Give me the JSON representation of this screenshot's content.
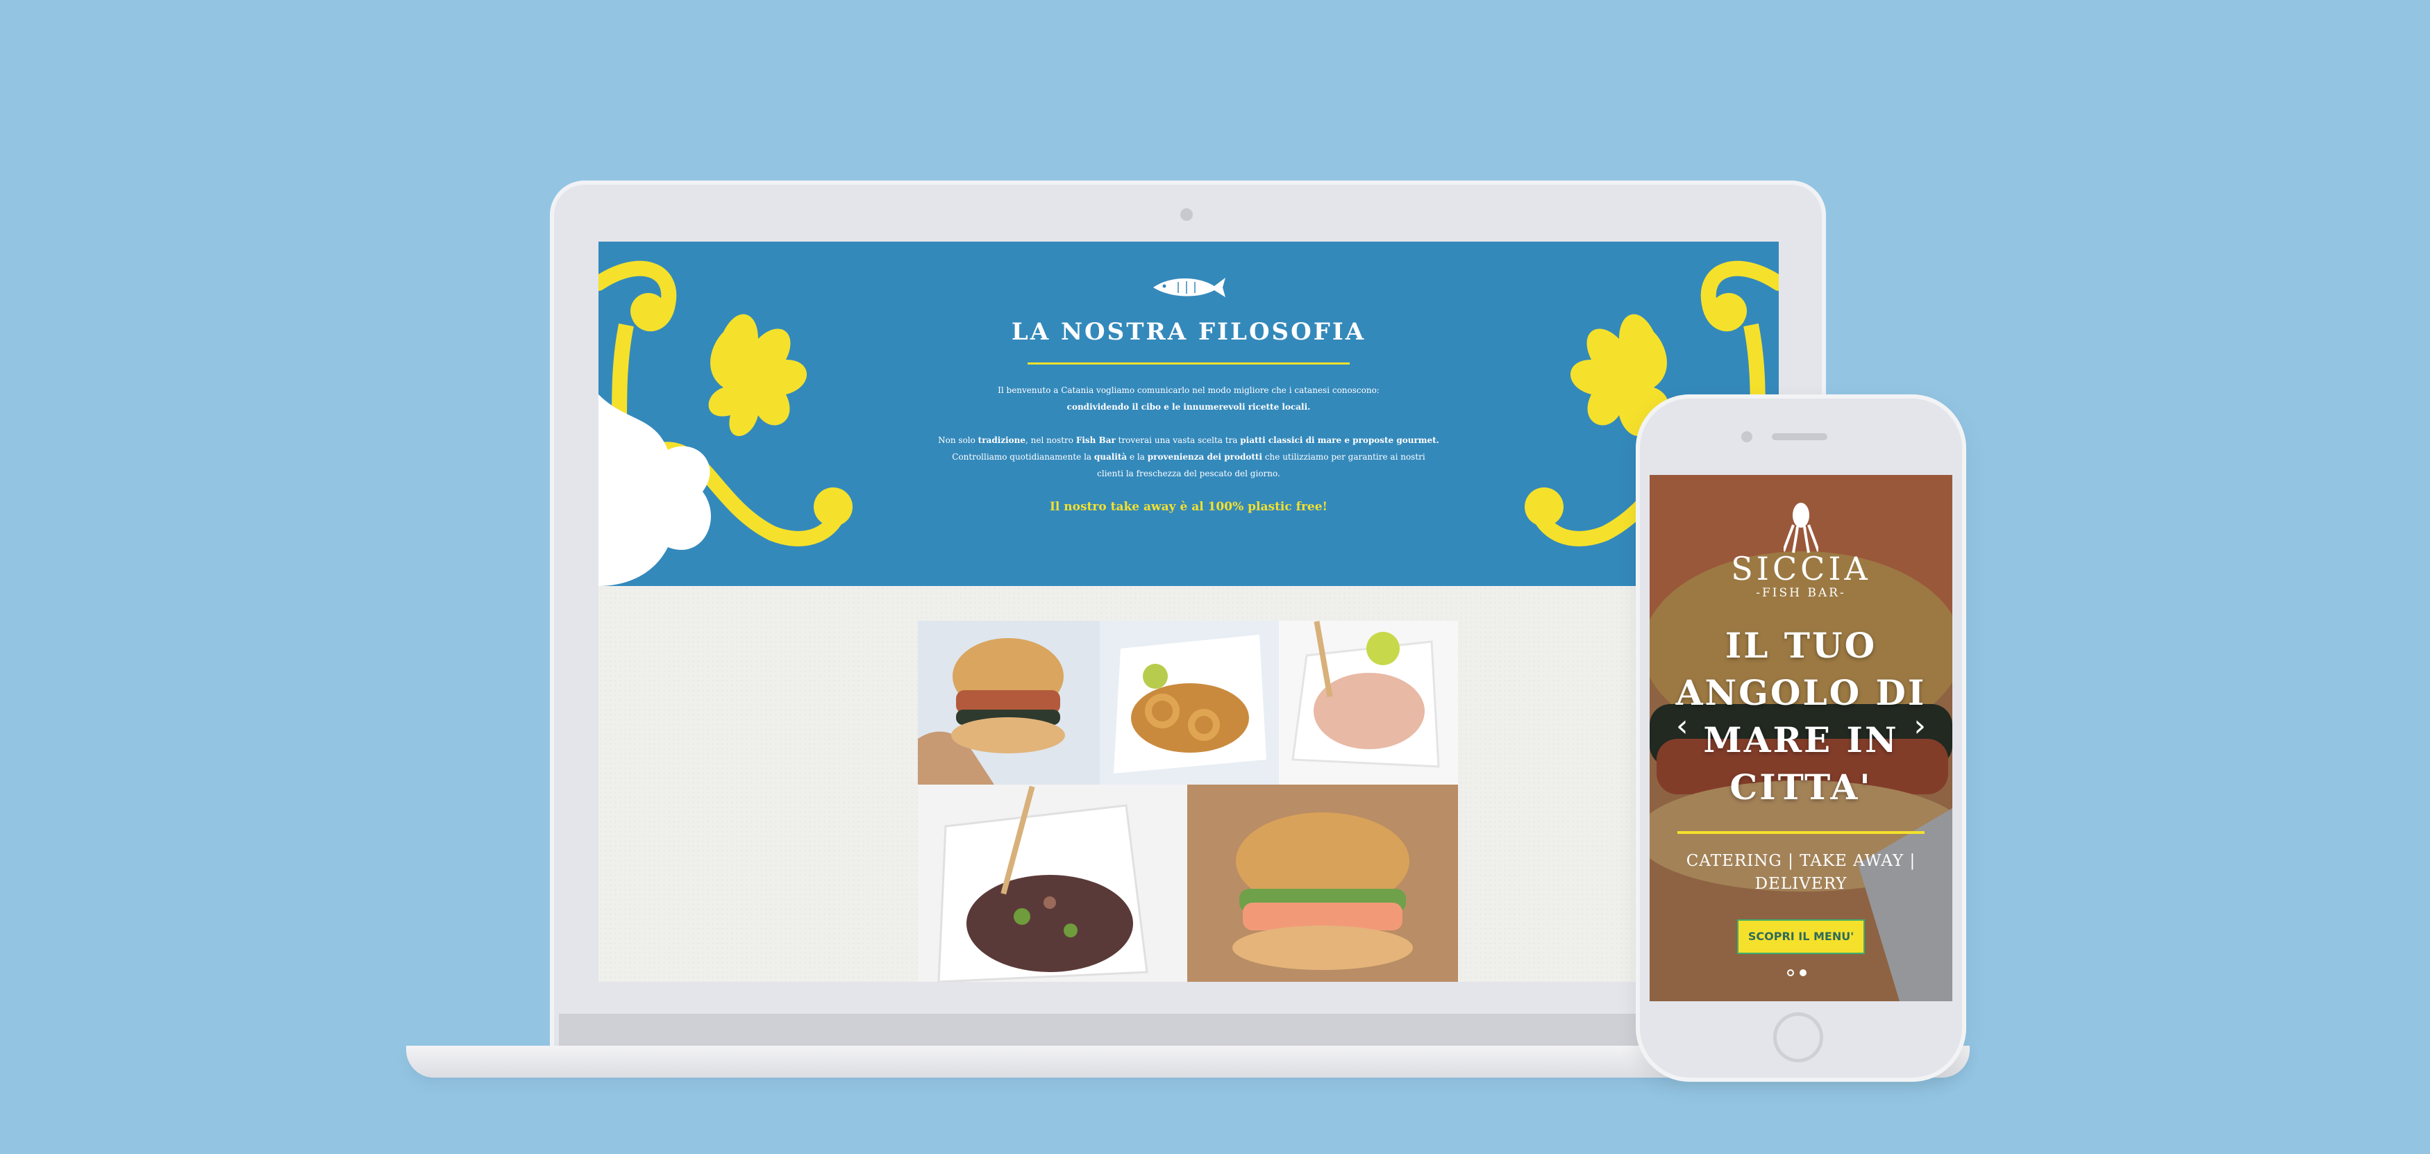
{
  "desktop": {
    "section_title": "LA NOSTRA FILOSOFIA",
    "intro": {
      "t1": "Il benvenuto a Catania vogliamo comunicarlo nel modo migliore che i catanesi conoscono:",
      "b1": "condividendo il cibo e le innumerevoli ricette locali."
    },
    "body": {
      "t1": "Non solo ",
      "b1": "tradizione",
      "t2": ", nel nostro ",
      "b2": "Fish Bar",
      "t3": " troverai una vasta scelta tra ",
      "b3": "piatti classici di mare e proposte gourmet.",
      "t4": "Controlliamo quotidianamente la ",
      "b4": "qualità",
      "t5": " e la ",
      "b5": "provenienza dei prodotti",
      "t6": " che utilizziamo per garantire ai nostri",
      "t7": "clienti la freschezza del pescato del giorno."
    },
    "takeaway": "Il nostro take away è al 100% plastic free!",
    "colors": {
      "hero_blue": "#3489bb",
      "accent_yellow": "#f5e12b"
    }
  },
  "mobile": {
    "brand": "SICCIA",
    "brand_sub": "-FISH BAR-",
    "headline": [
      "IL TUO",
      "ANGOLO DI",
      "MARE IN",
      "CITTA'"
    ],
    "services": [
      "CATERING | TAKE AWAY |",
      "DELIVERY"
    ],
    "menu_button": "SCOPRI IL MENU'",
    "prev_arrow": "‹",
    "next_arrow": "›"
  }
}
